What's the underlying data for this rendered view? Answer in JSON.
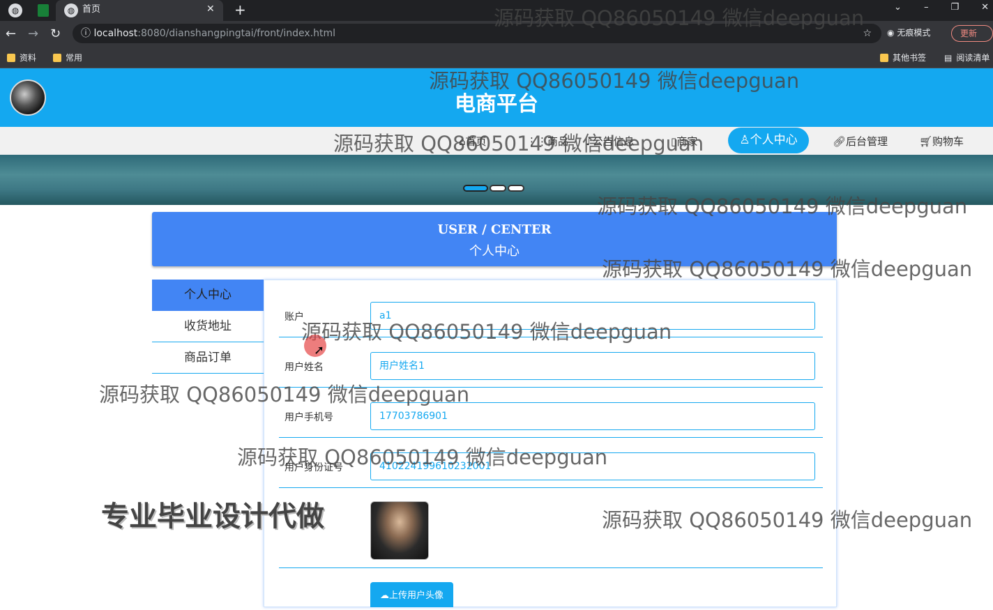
{
  "browser": {
    "tab_title": "首页",
    "url_host": "localhost",
    "url_rest": ":8080/dianshangpingtai/front/index.html",
    "incognito_label": "无痕模式",
    "update_label": "更新",
    "bookmarks": [
      "资料",
      "常用"
    ],
    "bookmarks_right": [
      "其他书签",
      "阅读清单"
    ]
  },
  "site": {
    "title": "电商平台",
    "nav": [
      "首页",
      "商品",
      "公告信息",
      "商家",
      "个人中心",
      "后台管理",
      "购物车"
    ],
    "active_nav": "个人中心",
    "banner_active_slide": 1,
    "banner_slides": 3
  },
  "user_center": {
    "heading_en": "USER / CENTER",
    "heading_cn": "个人中心",
    "menu": [
      "个人中心",
      "收货地址",
      "商品订单"
    ],
    "fields": [
      {
        "label": "账户",
        "value": "a1"
      },
      {
        "label": "用户姓名",
        "value": "用户姓名1"
      },
      {
        "label": "用户手机号",
        "value": "17703786901"
      },
      {
        "label": "用户身份证号",
        "value": "410224199610232001"
      }
    ],
    "upload_label": "上传用户头像"
  },
  "overlay": {
    "watermark": "源码获取 QQ86050149 微信deepguan",
    "promo": "专业毕业设计代做"
  },
  "colors": {
    "brand": "#14a8f0",
    "accent": "#4285f4"
  }
}
